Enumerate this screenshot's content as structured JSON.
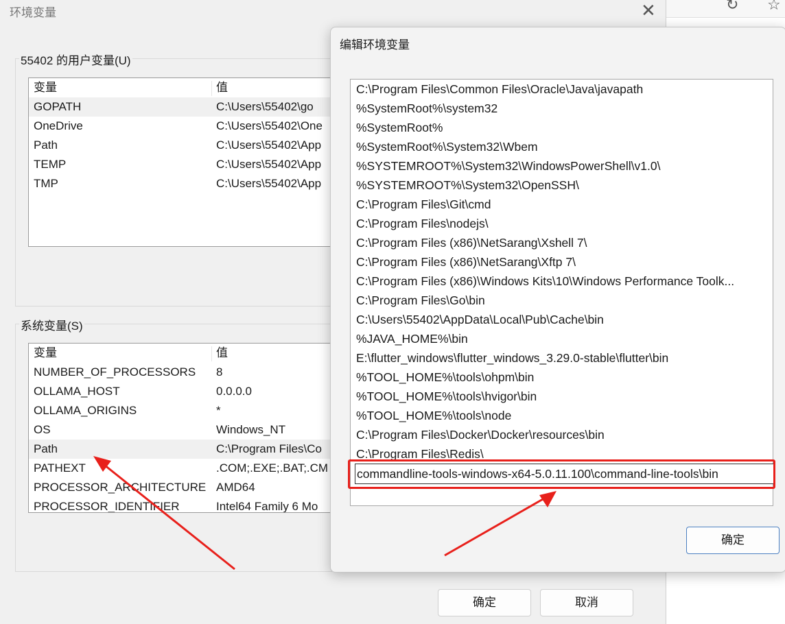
{
  "main_window": {
    "title": "环境变量",
    "close_glyph": "✕",
    "user_vars": {
      "label": "55402 的用户变量(U)",
      "col_name": "变量",
      "col_value": "值",
      "rows": [
        {
          "name": "GOPATH",
          "value": "C:\\Users\\55402\\go"
        },
        {
          "name": "OneDrive",
          "value": "C:\\Users\\55402\\One"
        },
        {
          "name": "Path",
          "value": "C:\\Users\\55402\\App"
        },
        {
          "name": "TEMP",
          "value": "C:\\Users\\55402\\App"
        },
        {
          "name": "TMP",
          "value": "C:\\Users\\55402\\App"
        }
      ]
    },
    "system_vars": {
      "label": "系统变量(S)",
      "col_name": "变量",
      "col_value": "值",
      "rows": [
        {
          "name": "NUMBER_OF_PROCESSORS",
          "value": "8"
        },
        {
          "name": "OLLAMA_HOST",
          "value": "0.0.0.0"
        },
        {
          "name": "OLLAMA_ORIGINS",
          "value": "*"
        },
        {
          "name": "OS",
          "value": "Windows_NT"
        },
        {
          "name": "Path",
          "value": "C:\\Program Files\\Co"
        },
        {
          "name": "PATHEXT",
          "value": ".COM;.EXE;.BAT;.CM"
        },
        {
          "name": "PROCESSOR_ARCHITECTURE",
          "value": "AMD64"
        },
        {
          "name": "PROCESSOR_IDENTIFIER",
          "value": "Intel64 Family 6 Mo"
        }
      ]
    },
    "ok_label": "确定",
    "cancel_label": "取消"
  },
  "edit_dialog": {
    "title": "编辑环境变量",
    "paths": [
      "C:\\Program Files\\Common Files\\Oracle\\Java\\javapath",
      "%SystemRoot%\\system32",
      "%SystemRoot%",
      "%SystemRoot%\\System32\\Wbem",
      "%SYSTEMROOT%\\System32\\WindowsPowerShell\\v1.0\\",
      "%SYSTEMROOT%\\System32\\OpenSSH\\",
      "C:\\Program Files\\Git\\cmd",
      "C:\\Program Files\\nodejs\\",
      "C:\\Program Files (x86)\\NetSarang\\Xshell 7\\",
      "C:\\Program Files (x86)\\NetSarang\\Xftp 7\\",
      "C:\\Program Files (x86)\\Windows Kits\\10\\Windows Performance Toolk...",
      "C:\\Program Files\\Go\\bin",
      "C:\\Users\\55402\\AppData\\Local\\Pub\\Cache\\bin",
      "%JAVA_HOME%\\bin",
      "E:\\flutter_windows\\flutter_windows_3.29.0-stable\\flutter\\bin",
      "%TOOL_HOME%\\tools\\ohpm\\bin",
      "%TOOL_HOME%\\tools\\hvigor\\bin",
      "%TOOL_HOME%\\tools\\node",
      "C:\\Program Files\\Docker\\Docker\\resources\\bin",
      "C:\\Program Files\\Redis\\"
    ],
    "editing_value": "commandline-tools-windows-x64-5.0.11.100\\command-line-tools\\bin",
    "ok_label": "确定"
  },
  "colors": {
    "annotation_red": "#e8201b",
    "window_bg": "#f0f0f0"
  },
  "browser": {
    "icons": [
      "refresh-icon",
      "star-icon"
    ]
  }
}
